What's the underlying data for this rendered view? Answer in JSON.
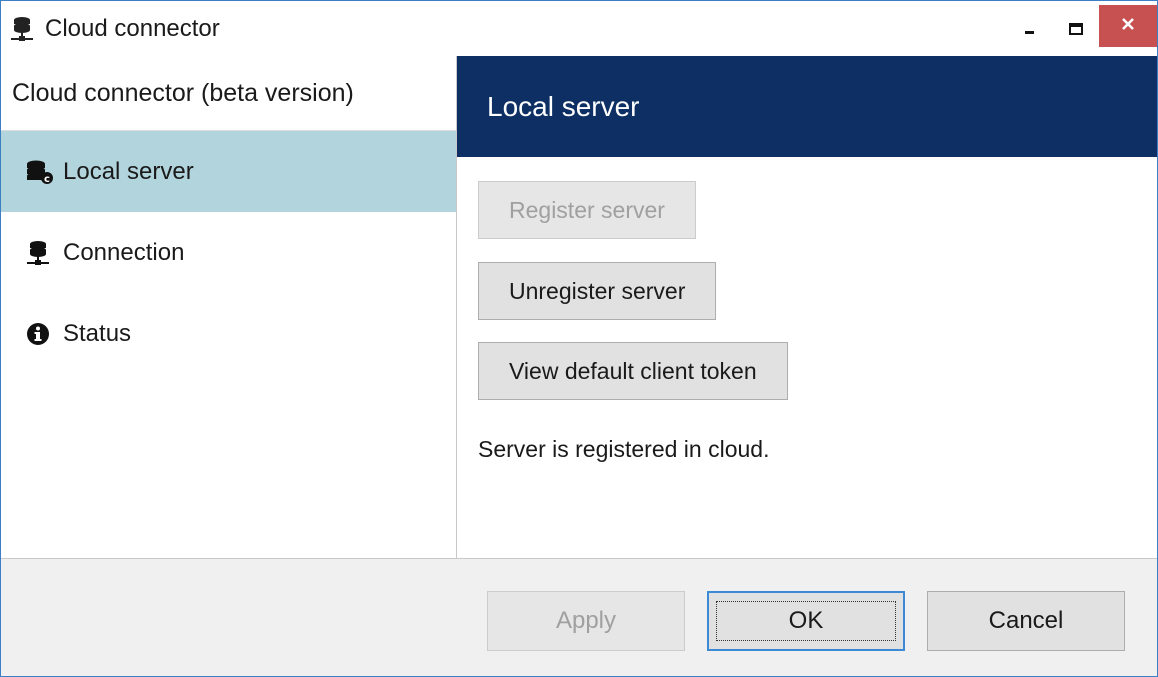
{
  "window": {
    "title": "Cloud connector",
    "icon": "server-connector-icon"
  },
  "controls": {
    "minimize_icon": "minimize-icon",
    "maximize_icon": "maximize-icon",
    "close_icon": "close-icon"
  },
  "sidebar": {
    "header": "Cloud connector (beta version)",
    "items": [
      {
        "label": "Local server",
        "icon": "local-server-icon",
        "active": true
      },
      {
        "label": "Connection",
        "icon": "connection-icon",
        "active": false
      },
      {
        "label": "Status",
        "icon": "info-icon",
        "active": false
      }
    ]
  },
  "main": {
    "header": "Local server",
    "buttons": {
      "register": "Register server",
      "unregister": "Unregister server",
      "view_token": "View default client token"
    },
    "status_text": "Server is registered in cloud."
  },
  "footer": {
    "apply": "Apply",
    "ok": "OK",
    "cancel": "Cancel"
  },
  "colors": {
    "header_bg": "#0d2f63",
    "active_item_bg": "#b2d5dd",
    "close_bg": "#c75050",
    "window_border": "#3c7fc5"
  }
}
